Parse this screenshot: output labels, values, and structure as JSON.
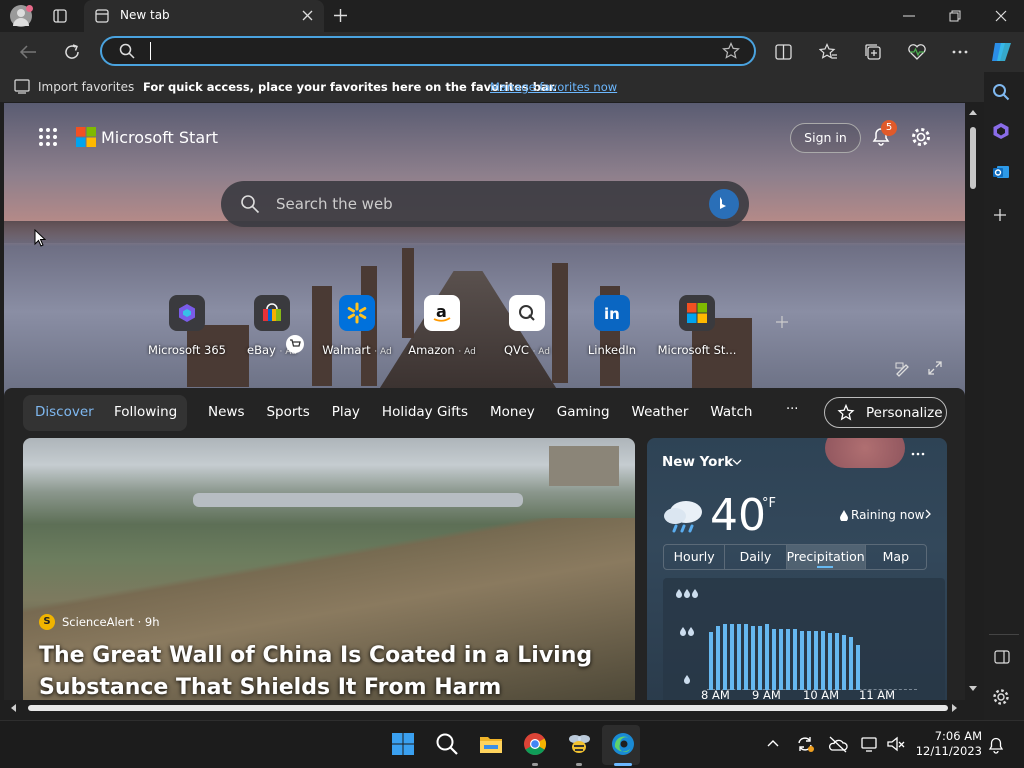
{
  "browser": {
    "tab_title": "New tab",
    "favorites_bar": {
      "import_label": "Import favorites",
      "message": "For quick access, place your favorites here on the favorites bar.",
      "manage_link": "Manage favorites now"
    }
  },
  "page": {
    "brand": "Microsoft Start",
    "sign_in": "Sign in",
    "notification_count": "5",
    "search_placeholder": "Search the web",
    "quick_links": [
      {
        "label": "Microsoft 365",
        "ad": ""
      },
      {
        "label": "eBay",
        "ad": "· Ad"
      },
      {
        "label": "Walmart",
        "ad": "· Ad"
      },
      {
        "label": "Amazon",
        "ad": "· Ad"
      },
      {
        "label": "QVC",
        "ad": "· Ad"
      },
      {
        "label": "LinkedIn",
        "ad": ""
      },
      {
        "label": "Microsoft St...",
        "ad": ""
      }
    ],
    "feed_tabs": {
      "discover": "Discover",
      "following": "Following",
      "items": [
        "News",
        "Sports",
        "Play",
        "Holiday Gifts",
        "Money",
        "Gaming",
        "Weather",
        "Watch"
      ],
      "more": "···",
      "personalize": "Personalize"
    },
    "article": {
      "source_initial": "S",
      "source": "ScienceAlert · 9h",
      "headline": "The Great Wall of China Is Coated in a Living Substance That Shields It From Harm"
    },
    "weather": {
      "city": "New York",
      "temperature": "40",
      "unit": "°F",
      "status": "Raining now",
      "tabs": [
        "Hourly",
        "Daily",
        "Precipitation",
        "Map"
      ],
      "selected_tab": "Precipitation"
    }
  },
  "chart_data": {
    "type": "bar",
    "x_labels": [
      "8 AM",
      "9 AM",
      "10 AM",
      "11 AM"
    ],
    "values": [
      0.55,
      0.6,
      0.62,
      0.62,
      0.62,
      0.62,
      0.6,
      0.6,
      0.62,
      0.58,
      0.58,
      0.58,
      0.58,
      0.56,
      0.56,
      0.56,
      0.56,
      0.54,
      0.54,
      0.52,
      0.5,
      0.42,
      0.0,
      0.0,
      0.0,
      0.0,
      0.0,
      0.0,
      0.0,
      0.0
    ],
    "ylim": [
      0,
      1
    ]
  },
  "taskbar": {
    "time": "7:06 AM",
    "date": "12/11/2023"
  },
  "colors": {
    "accent": "#4aa3df",
    "link": "#6cb8ff",
    "bar": "#66b8f0"
  }
}
